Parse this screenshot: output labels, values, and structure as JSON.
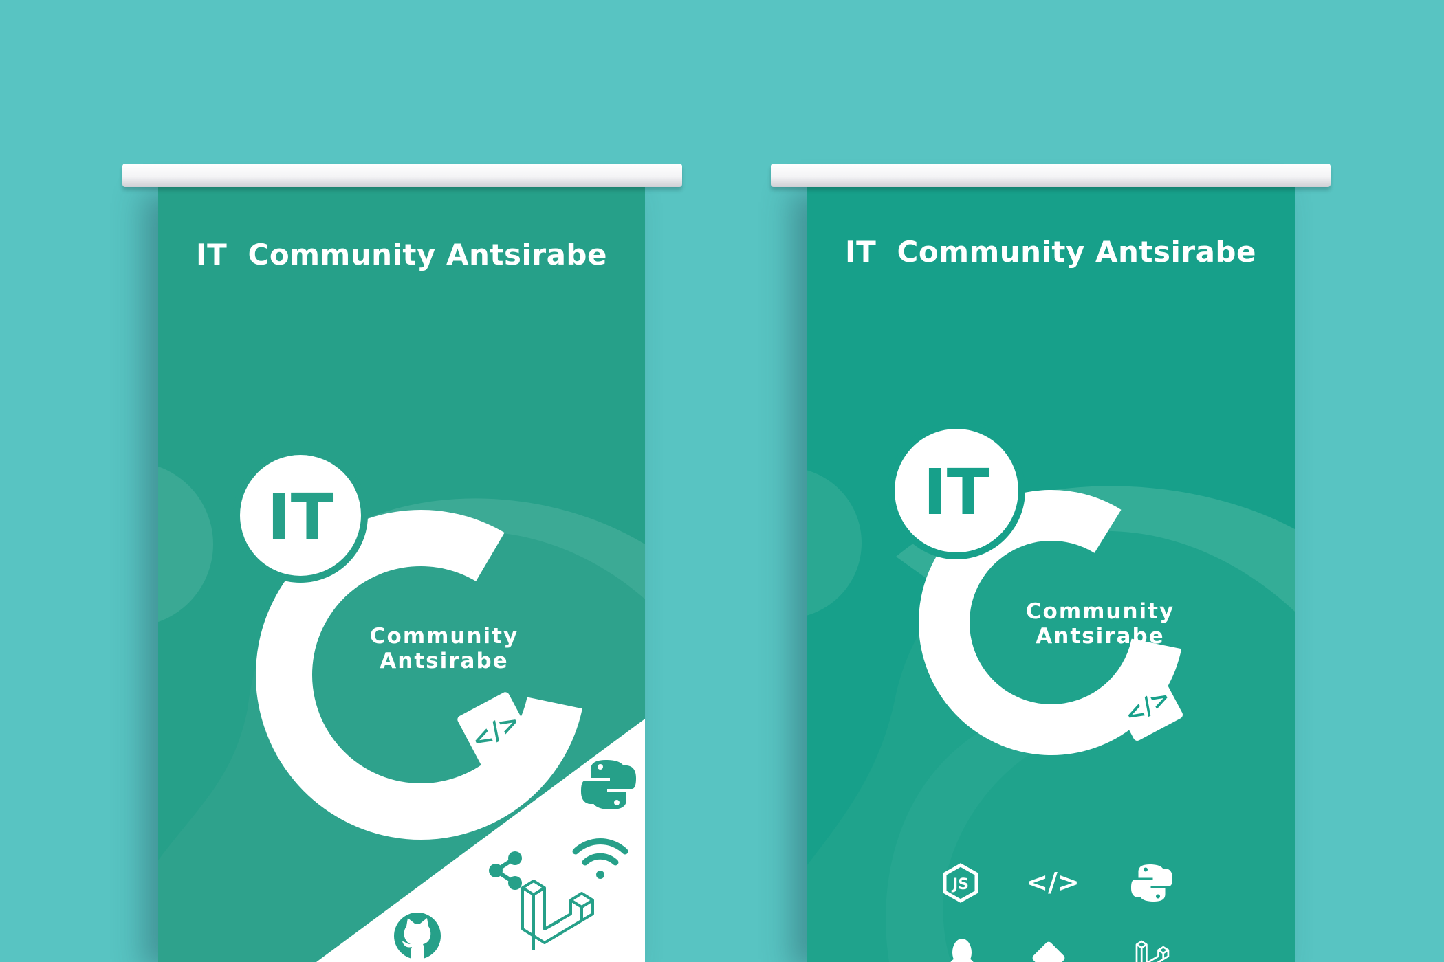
{
  "colors": {
    "background": "#58c4c2",
    "banner_left": "#26a089",
    "banner_right": "#17a08a",
    "logo": "#ffffff"
  },
  "banner_left": {
    "title": "IT  Community Antsirabe",
    "logo": {
      "badge": "IT",
      "line1": "Community",
      "line2": "Antsirabe"
    },
    "icons": [
      "python-icon",
      "wifi-icon",
      "share-icon",
      "github-icon",
      "laravel-icon"
    ]
  },
  "banner_right": {
    "title": "IT  Community Antsirabe",
    "logo": {
      "badge": "IT",
      "line1": "Community",
      "line2": "Antsirabe"
    },
    "icons": [
      "nodejs-icon",
      "code-icon",
      "python-icon",
      "linux-icon",
      "git-icon",
      "laravel-icon"
    ]
  }
}
